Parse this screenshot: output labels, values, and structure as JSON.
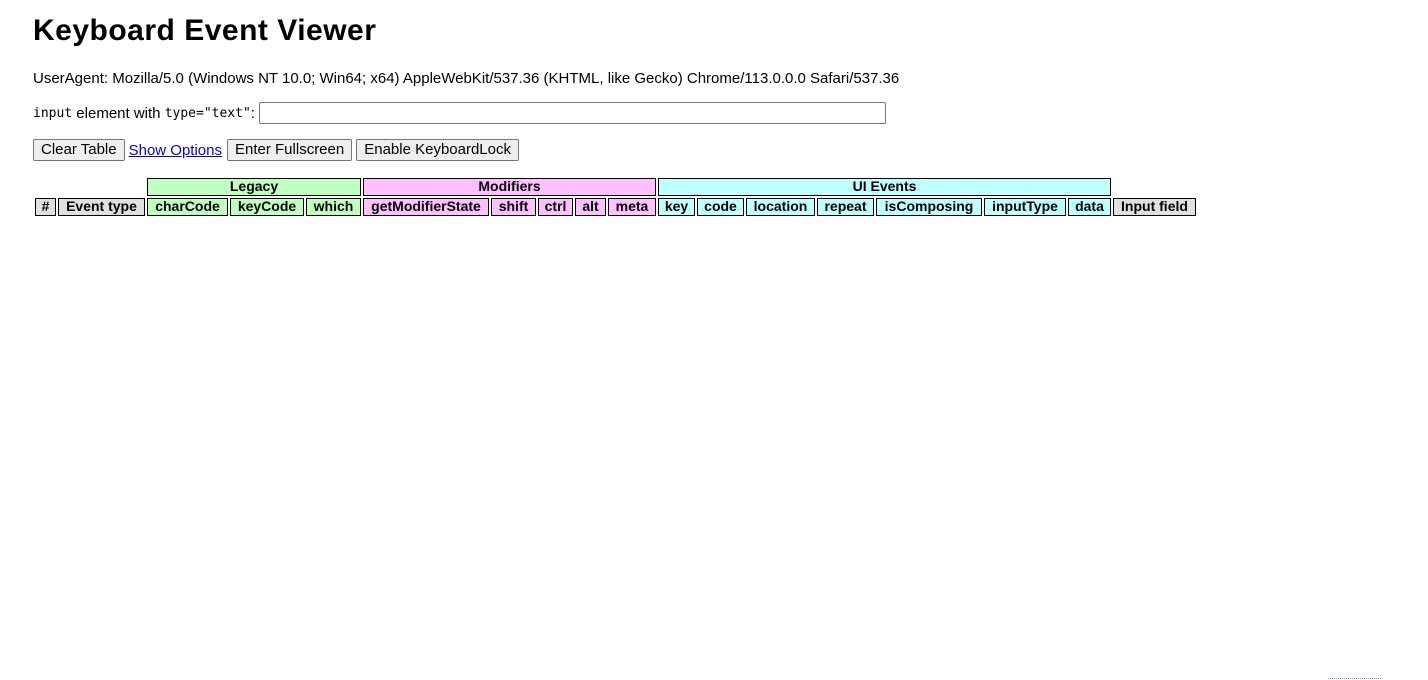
{
  "page": {
    "title": "Keyboard Event Viewer",
    "user_agent": "UserAgent: Mozilla/5.0 (Windows NT 10.0; Win64; x64) AppleWebKit/537.36 (KHTML, like Gecko) Chrome/113.0.0.0 Safari/537.36"
  },
  "input_row": {
    "code_input": "input",
    "label_middle": " element with ",
    "code_type": "type=\"text\"",
    "label_end": ":",
    "value": "",
    "placeholder": ""
  },
  "buttons": {
    "clear_table": "Clear Table",
    "show_options": "Show Options",
    "enter_fullscreen": "Enter Fullscreen",
    "enable_keyboard_lock": "Enable KeyboardLock"
  },
  "table": {
    "groups": {
      "legacy": "Legacy",
      "modifiers": "Modifiers",
      "ui_events": "UI Events"
    },
    "headers": {
      "num": "#",
      "event_type": "Event type",
      "charCode": "charCode",
      "keyCode": "keyCode",
      "which": "which",
      "getModifierState": "getModifierState",
      "shift": "shift",
      "ctrl": "ctrl",
      "alt": "alt",
      "meta": "meta",
      "key": "key",
      "code": "code",
      "location": "location",
      "repeat": "repeat",
      "isComposing": "isComposing",
      "inputType": "inputType",
      "data": "data",
      "input_field": "Input field"
    },
    "rows": []
  },
  "colors": {
    "legacy": "#c0ffc0",
    "modifiers": "#ffc0ff",
    "ui_events": "#c0ffff",
    "plain": "#e0e0e0",
    "link": "#0000ee"
  }
}
